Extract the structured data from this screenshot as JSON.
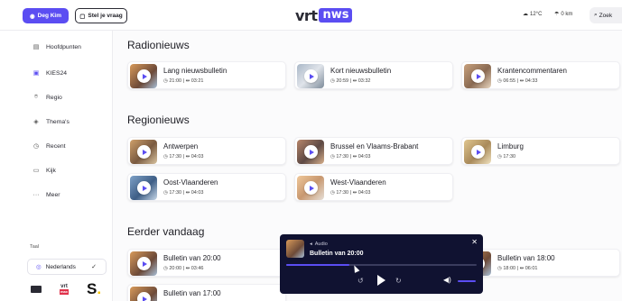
{
  "header": {
    "user_button": "Deg Kim",
    "ask_button": "Stel je vraag",
    "logo_vrt": "vrt",
    "logo_nws": "nws",
    "temperature": "12°C",
    "rain": "0 km",
    "search_label": "Zoek"
  },
  "sidebar": {
    "items": [
      {
        "label": "Hoofdpunten",
        "icon": "newspaper-icon"
      },
      {
        "label": "KIES24",
        "icon": "ballot-icon"
      },
      {
        "label": "Regio",
        "icon": "location-pin-icon"
      },
      {
        "label": "Thema's",
        "icon": "layers-icon"
      },
      {
        "label": "Recent",
        "icon": "clock-icon"
      },
      {
        "label": "Kijk",
        "icon": "video-icon"
      },
      {
        "label": "Meer",
        "icon": "more-dots-icon"
      }
    ],
    "language_label": "Taal",
    "language_value": "Nederlands"
  },
  "sections": {
    "radio": {
      "title": "Radionieuws",
      "cards": [
        {
          "title": "Lang nieuwsbulletin",
          "time": "21:00",
          "duration": "03:21"
        },
        {
          "title": "Kort nieuwsbulletin",
          "time": "20:59",
          "duration": "03:32"
        },
        {
          "title": "Krantencommentaren",
          "time": "06:55",
          "duration": "04:33"
        }
      ]
    },
    "regio": {
      "title": "Regionieuws",
      "cards": [
        {
          "title": "Antwerpen",
          "time": "17:30",
          "duration": "04:03"
        },
        {
          "title": "Brussel en Vlaams-Brabant",
          "time": "17:30",
          "duration": "04:03"
        },
        {
          "title": "Limburg",
          "time": "17:30",
          "duration": "04:03"
        },
        {
          "title": "Oost-Vlaanderen",
          "time": "17:30",
          "duration": "04:03"
        },
        {
          "title": "West-Vlaanderen",
          "time": "17:30",
          "duration": "04:03"
        }
      ]
    },
    "earlier": {
      "title": "Eerder vandaag",
      "cards": [
        {
          "title": "Bulletin van 20:00",
          "time": "20:00",
          "duration": "03:46"
        },
        {
          "title": "Bulletin van 18:00",
          "time": "18:00",
          "duration": "06:01"
        },
        {
          "title": "Bulletin van 17:00"
        }
      ]
    }
  },
  "player": {
    "kind": "Audio",
    "title": "Bulletin van 20:00",
    "progress": 0.33
  },
  "colors": {
    "accent": "#5b4df2",
    "player_bg": "#101231"
  }
}
